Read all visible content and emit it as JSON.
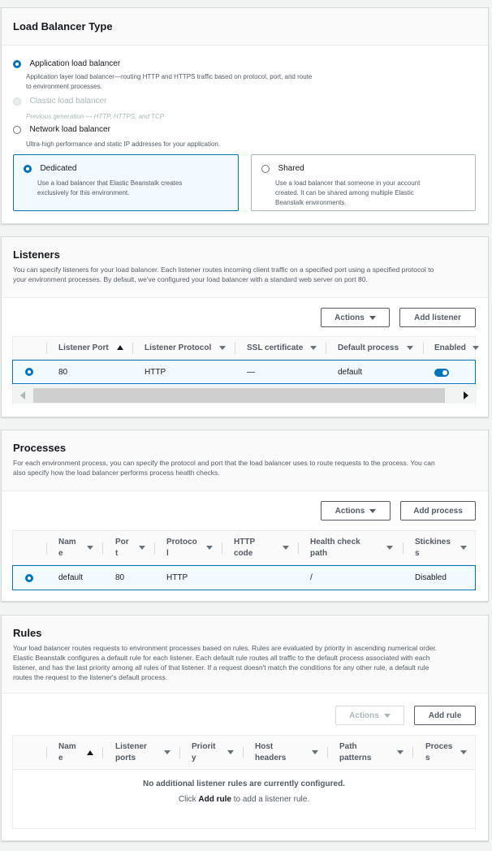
{
  "lb_type": {
    "title": "Load Balancer Type",
    "options": [
      {
        "label": "Application load balancer",
        "desc": "Application layer load balancer—routing HTTP and HTTPS traffic based on protocol, port, and route",
        "desc2": "to environment processes."
      },
      {
        "label": "Classic load balancer",
        "desc": "Previous generation — HTTP, HTTPS, and TCP"
      },
      {
        "label": "Network load balancer",
        "desc": "Ultra-high performance and static IP addresses for your application."
      }
    ],
    "tiles": [
      {
        "label": "Dedicated",
        "desc": "Use a load balancer that Elastic Beanstalk creates",
        "desc2": "exclusively for this environment."
      },
      {
        "label": "Shared",
        "desc": "Use a load balancer that someone in your account",
        "desc2": "created. It can be shared among multiple Elastic",
        "desc3": "Beanstalk environments."
      }
    ]
  },
  "listeners": {
    "title": "Listeners",
    "desc": "You can specify listeners for your load balancer. Each listener routes incoming client traffic on a specified port using a specified protocol to",
    "desc2": "your environment processes. By default, we've configured your load balancer with a standard web server on port 80.",
    "actions_label": "Actions",
    "add_label": "Add listener",
    "columns": [
      "Listener Port",
      "Listener Protocol",
      "SSL certificate",
      "Default process",
      "Enabled"
    ],
    "row": {
      "port": "80",
      "protocol": "HTTP",
      "ssl": "—",
      "process": "default",
      "enabled": true
    }
  },
  "processes": {
    "title": "Processes",
    "desc": "For each environment process, you can specify the protocol and port that the load balancer uses to route requests to the process. You can",
    "desc2": "also specify how the load balancer performs process health checks.",
    "actions_label": "Actions",
    "add_label": "Add process",
    "columns": [
      {
        "l1": "Nam",
        "l2": "e"
      },
      {
        "l1": "Por",
        "l2": "t"
      },
      {
        "l1": "Protoco",
        "l2": "l"
      },
      {
        "l1": "HTTP",
        "l2": "code"
      },
      {
        "l1": "Health check",
        "l2": "path"
      },
      {
        "l1": "Stickines",
        "l2": "s"
      }
    ],
    "row": {
      "name": "default",
      "port": "80",
      "protocol": "HTTP",
      "code": "",
      "path": "/",
      "stickiness": "Disabled"
    }
  },
  "rules": {
    "title": "Rules",
    "desc": "Your load balancer routes requests to environment processes based on rules. Rules are evaluated by priority in ascending numerical order.",
    "desc2": "Elastic Beanstalk configures a default rule for each listener. Each default rule routes all traffic to the default process associated with each",
    "desc3": "listener, and has the last priority among all rules of that listener. If a request doesn't match the conditions for any other rule, a default rule",
    "desc4": "routes the request to the listener's default process.",
    "actions_label": "Actions",
    "add_label": "Add rule",
    "columns": [
      {
        "l1": "Nam",
        "l2": "e"
      },
      {
        "l1": "Listener",
        "l2": "ports"
      },
      {
        "l1": "Priorit",
        "l2": "y"
      },
      {
        "l1": "Host",
        "l2": "headers"
      },
      {
        "l1": "Path",
        "l2": "patterns"
      },
      {
        "l1": "Proces",
        "l2": "s"
      }
    ],
    "empty_title": "No additional listener rules are currently configured.",
    "empty_pre": "Click ",
    "empty_link": "Add rule",
    "empty_post": " to add a listener rule."
  },
  "colors": {
    "accent": "#0073bb",
    "border": "#d5dbdb",
    "text": "#16191f",
    "muted": "#545b64"
  }
}
